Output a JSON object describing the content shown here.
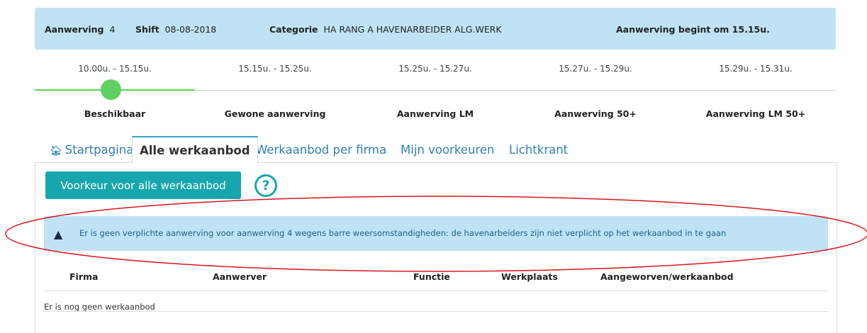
{
  "info": {
    "aanwerving_label": "Aanwerving",
    "aanwerving_value": "4",
    "shift_label": "Shift",
    "shift_value": "08-08-2018",
    "categorie_label": "Categorie",
    "categorie_value": "HA RANG A HAVENARBEIDER ALG.WERK",
    "begint": "Aanwerving begint om 15.15u."
  },
  "timeline": {
    "times": [
      "10.00u. - 15.15u.",
      "15.15u. - 15.25u.",
      "15.25u. - 15.27u.",
      "15.27u. - 15.29u.",
      "15.29u. - 15.31u."
    ],
    "phases": [
      "Beschikbaar",
      "Gewone aanwerving",
      "Aanwerving LM",
      "Aanwerving 50+",
      "Aanwerving LM 50+"
    ],
    "progress_color": "#5fd061"
  },
  "tabs": {
    "home": "Startpagina",
    "alle": "Alle werkaanbod",
    "per_firma": "Werkaanbod per firma",
    "voorkeuren": "Mijn voorkeuren",
    "lichtkrant": "Lichtkrant"
  },
  "actions": {
    "voorkeur_button": "Voorkeur voor alle werkaanbod",
    "help_glyph": "?"
  },
  "alert": {
    "text": "Er is geen verplichte aanwerving voor aanwerving 4 wegens barre weersomstandigheden: de havenarbeiders zijn niet verplicht op het werkaanbod in te gaan",
    "icon": "warning-icon"
  },
  "table": {
    "headers": [
      "Firma",
      "Aanwerver",
      "Functie",
      "Werkplaats",
      "Aangeworven/werkaanbod"
    ],
    "empty_text": "Er is nog geen werkaanbod"
  },
  "colors": {
    "accent": "#17a6ad",
    "info_bg": "#bfe3f4",
    "annotation": "#d9161c"
  }
}
